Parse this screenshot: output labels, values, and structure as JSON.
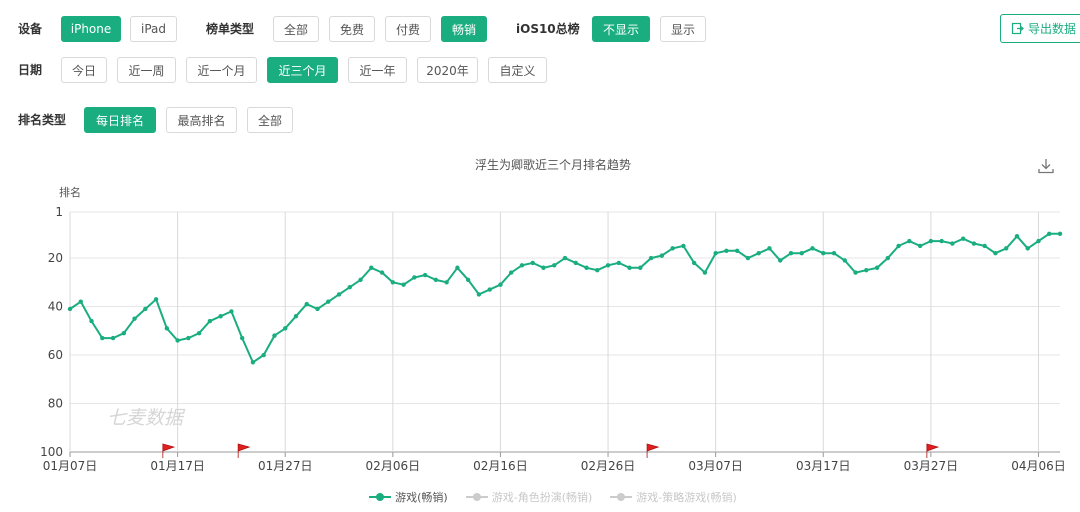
{
  "filters": {
    "device_label": "设备",
    "device_options": [
      "iPhone",
      "iPad"
    ],
    "device_selected": 0,
    "list_type_label": "榜单类型",
    "list_type_options": [
      "全部",
      "免费",
      "付费",
      "畅销"
    ],
    "list_type_selected": 3,
    "ios10_label": "iOS10总榜",
    "ios10_options": [
      "不显示",
      "显示"
    ],
    "ios10_selected": 0,
    "date_label": "日期",
    "date_options": [
      "今日",
      "近一周",
      "近一个月",
      "近三个月",
      "近一年",
      "2020年",
      "自定义"
    ],
    "date_selected": 3,
    "rank_type_label": "排名类型",
    "rank_type_options": [
      "每日排名",
      "最高排名",
      "全部"
    ],
    "rank_type_selected": 0
  },
  "export_label": "导出数据",
  "accent_color": "#1aad80",
  "chart_data": {
    "type": "line",
    "title": "浮生为卿歌近三个月排名趋势",
    "ylabel": "排名",
    "ylim": [
      1,
      100
    ],
    "y_reversed": true,
    "y_ticks": [
      "1",
      "20",
      "40",
      "60",
      "80",
      "100"
    ],
    "x_ticks": [
      "01月07日",
      "01月17日",
      "01月27日",
      "02月06日",
      "02月16日",
      "02月26日",
      "03月07日",
      "03月17日",
      "03月27日",
      "04月06日"
    ],
    "watermark": "七麦数据",
    "flags_on_days": [
      9,
      16,
      54,
      80
    ],
    "series": [
      {
        "name": "游戏(畅销)",
        "color": "#1aad80",
        "start": "01月07日",
        "values": [
          41,
          38,
          46,
          53,
          53,
          51,
          45,
          41,
          37,
          49,
          54,
          53,
          51,
          46,
          44,
          42,
          53,
          63,
          60,
          52,
          49,
          44,
          39,
          41,
          38,
          35,
          32,
          29,
          24,
          26,
          30,
          31,
          28,
          27,
          29,
          30,
          24,
          29,
          35,
          33,
          31,
          26,
          23,
          22,
          24,
          23,
          20,
          22,
          24,
          25,
          23,
          22,
          24,
          24,
          20,
          19,
          16,
          15,
          22,
          26,
          18,
          17,
          17,
          20,
          18,
          16,
          21,
          18,
          18,
          16,
          18,
          18,
          21,
          26,
          25,
          24,
          20,
          15,
          13,
          15,
          13,
          13,
          14,
          12,
          14,
          15,
          18,
          16,
          11,
          16,
          13,
          10,
          10
        ]
      },
      {
        "name": "游戏-角色扮演(畅销)",
        "color": "#cccccc",
        "values": []
      },
      {
        "name": "游戏-策略游戏(畅销)",
        "color": "#cccccc",
        "values": []
      }
    ]
  }
}
